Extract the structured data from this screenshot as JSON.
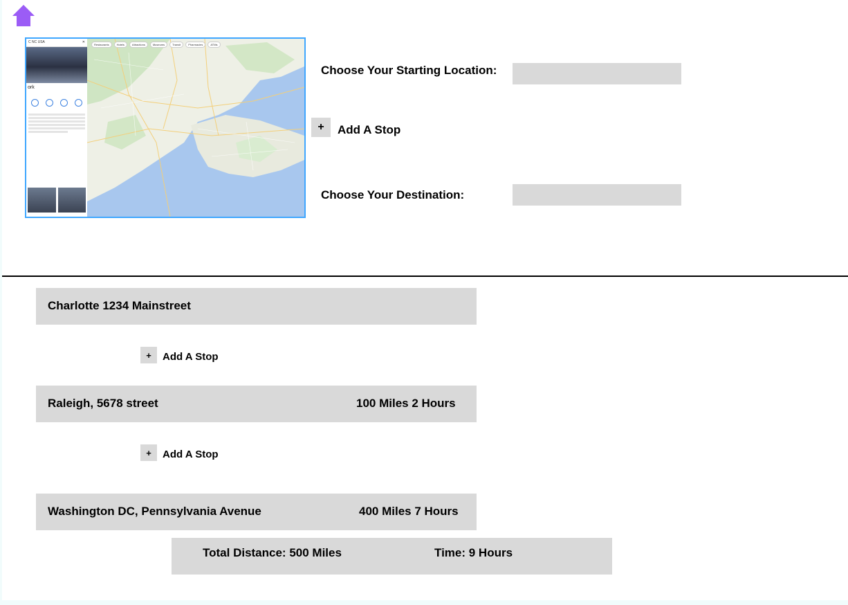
{
  "colors": {
    "home_icon": "#9b5cf6",
    "input_bg": "#d9d9d9",
    "map_border": "#3ea6ff"
  },
  "home": {
    "icon": "home-icon"
  },
  "map_preview": {
    "search_text": "C NC USA",
    "place_title": "ork",
    "chips": [
      "Restaurants",
      "Hotels",
      "Attractions",
      "Museums",
      "Transit",
      "Pharmacies",
      "ATMs"
    ]
  },
  "form": {
    "start_label": "Choose Your Starting Location:",
    "start_value": "",
    "add_stop_icon": "+",
    "add_stop_label": "Add  A Stop",
    "destination_label": "Choose Your Destination:",
    "destination_value": ""
  },
  "route": {
    "stops": [
      {
        "address": "Charlotte 1234 Mainstreet",
        "meta": ""
      },
      {
        "address": "Raleigh, 5678 street",
        "meta": "100 Miles 2 Hours"
      },
      {
        "address": "Washington DC, Pennsylvania Avenue",
        "meta": "400 Miles 7 Hours"
      }
    ],
    "add_stop_icon": "+",
    "add_stop_label": "Add  A Stop"
  },
  "totals": {
    "distance": "Total Distance: 500 Miles",
    "time": "Time: 9 Hours"
  }
}
